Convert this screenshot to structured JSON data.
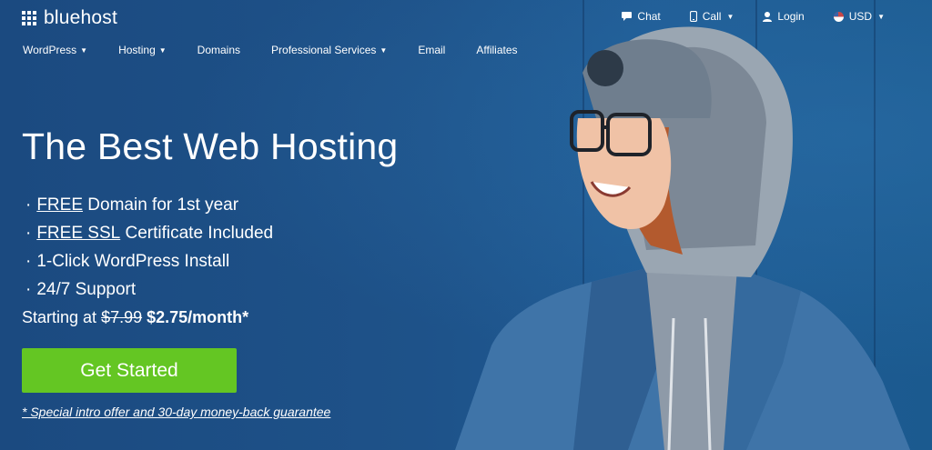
{
  "brand": {
    "name": "bluehost"
  },
  "topnav": [
    {
      "label": "Chat",
      "icon": "chat-icon"
    },
    {
      "label": "Call",
      "icon": "phone-icon"
    },
    {
      "label": "Login",
      "icon": "user-icon"
    },
    {
      "label": "USD",
      "icon": "us-flag-icon"
    }
  ],
  "mainnav": [
    {
      "label": "WordPress"
    },
    {
      "label": "Hosting"
    },
    {
      "label": "Domains"
    },
    {
      "label": "Professional Services"
    },
    {
      "label": "Email"
    },
    {
      "label": "Affiliates"
    }
  ],
  "hero": {
    "headline": "The Best Web Hosting",
    "features": [
      {
        "highlight": "FREE",
        "rest": " Domain for 1st year"
      },
      {
        "highlight": "FREE SSL",
        "rest": " Certificate Included"
      },
      {
        "highlight": "",
        "rest": "1-Click WordPress Install"
      },
      {
        "highlight": "",
        "rest": "24/7 Support"
      }
    ],
    "price_prefix": "Starting at",
    "price_old": "$7.99",
    "price_new": "$2.75/month*",
    "cta_label": "Get Started",
    "disclaimer": "* Special intro offer and 30-day money-back guarantee"
  },
  "colors": {
    "background": "#1d4f86",
    "cta": "#64c623",
    "text": "#ffffff"
  }
}
